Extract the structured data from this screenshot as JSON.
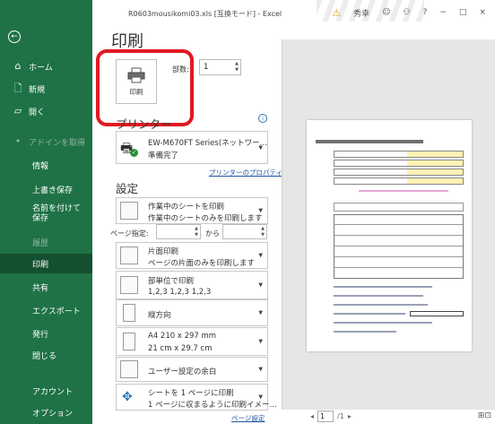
{
  "window": {
    "title": "R0603mousikomi03.xls [互換モード] - Excel",
    "user": "秀幸",
    "buttons": {
      "help": "?",
      "minimize": "−",
      "restore": "□",
      "close": "×"
    }
  },
  "sidebar": {
    "items": [
      {
        "label": "ホーム",
        "icon": "home-icon"
      },
      {
        "label": "新規",
        "icon": "new-document-icon"
      },
      {
        "label": "開く",
        "icon": "open-folder-icon"
      },
      {
        "label": "アドインを取得"
      },
      {
        "label": "情報"
      },
      {
        "label": "上書き保存"
      },
      {
        "label": "名前を付けて保存"
      },
      {
        "label": "履歴"
      },
      {
        "label": "印刷"
      },
      {
        "label": "共有"
      },
      {
        "label": "エクスポート"
      },
      {
        "label": "発行"
      },
      {
        "label": "閉じる"
      },
      {
        "label": "アカウント"
      },
      {
        "label": "オプション"
      }
    ]
  },
  "print": {
    "heading": "印刷",
    "button_label": "印刷",
    "copies_label": "部数:",
    "copies_value": "1"
  },
  "printer": {
    "section_title": "プリンター",
    "name": "EW-M670FT Series(ネットワー…",
    "status": "準備完了",
    "properties_link": "プリンターのプロパティ"
  },
  "settings": {
    "section_title": "設定",
    "scope": {
      "line1": "作業中のシートを印刷",
      "line2": "作業中のシートのみを印刷します"
    },
    "pages_label": "ページ指定:",
    "pages_from": "",
    "pages_to_label": "から",
    "pages_to": "",
    "sides": {
      "line1": "片面印刷",
      "line2": "ページの片面のみを印刷します"
    },
    "collate": {
      "line1": "部単位で印刷",
      "line2": "1,2,3    1,2,3    1,2,3"
    },
    "orientation": {
      "line1": "縦方向"
    },
    "paper": {
      "line1": "A4 210 x 297 mm",
      "line2": "21 cm x 29.7 cm"
    },
    "margins": {
      "line1": "ユーザー設定の余白"
    },
    "scaling": {
      "line1": "シートを 1 ページに印刷",
      "line2": "1 ページに収まるように印刷イメー…"
    },
    "page_setup_link": "ページ設定"
  },
  "preview": {
    "current_page": "1",
    "total_pages": "/1"
  }
}
